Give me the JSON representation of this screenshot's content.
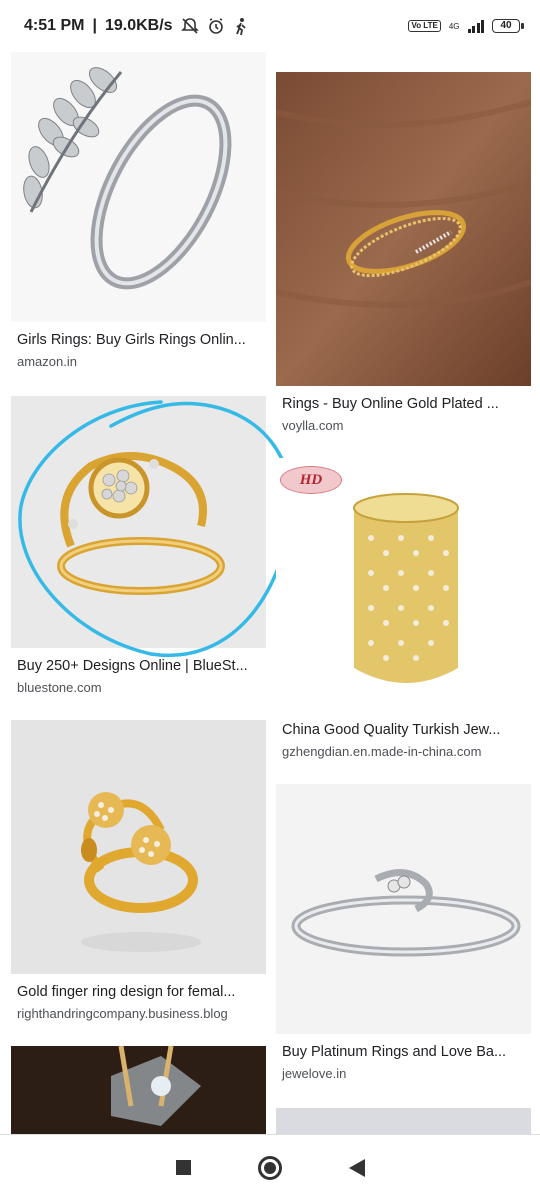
{
  "status_bar": {
    "time": "4:51 PM",
    "separator": "|",
    "speed": "19.0KB/s",
    "volte": "Vo LTE",
    "network": "4G",
    "battery": "40"
  },
  "results": [
    {
      "caption": "Girls Rings: Buy Girls Rings Onlin...",
      "domain": "amazon.in"
    },
    {
      "caption": "Rings - Buy Online Gold Plated ...",
      "domain": "voylla.com"
    },
    {
      "caption": "Buy 250+ Designs Online | BlueSt...",
      "domain": "bluestone.com"
    },
    {
      "caption": "China Good Quality Turkish Jew...",
      "domain": "gzhengdian.en.made-in-china.com",
      "watermark": "HD"
    },
    {
      "caption": "Gold finger ring design for femal...",
      "domain": "righthandringcompany.business.blog"
    },
    {
      "caption": "Buy Platinum Rings and Love Ba...",
      "domain": "jewelove.in"
    },
    {
      "caption": "",
      "domain": ""
    },
    {
      "caption": "",
      "domain": ""
    }
  ],
  "colors": {
    "annotation": "#35b9e6",
    "gold": "#d9a431",
    "silver": "#b9bcc1"
  }
}
